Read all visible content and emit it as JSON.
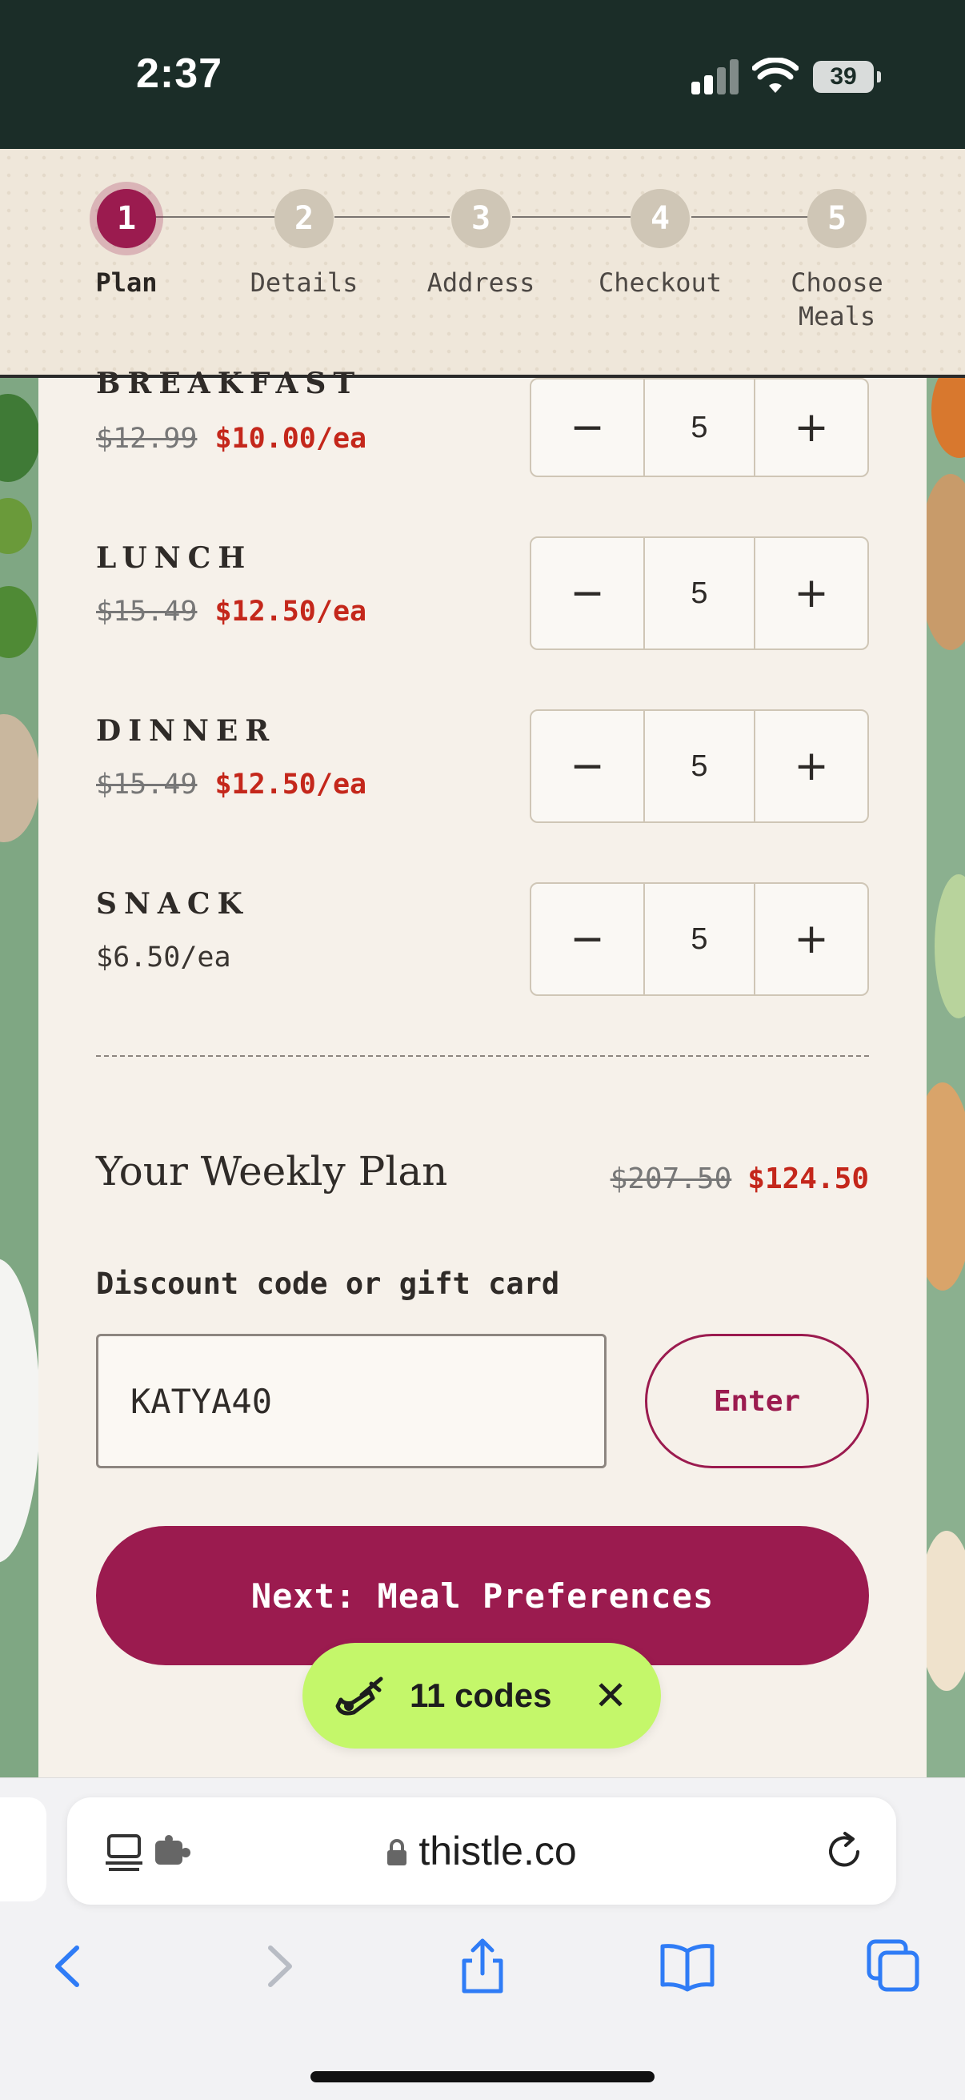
{
  "status_bar": {
    "time": "2:37",
    "battery": "39"
  },
  "stepper": {
    "steps": [
      {
        "number": "1",
        "label": "Plan"
      },
      {
        "number": "2",
        "label": "Details"
      },
      {
        "number": "3",
        "label": "Address"
      },
      {
        "number": "4",
        "label": "Checkout"
      },
      {
        "number": "5",
        "label_line1": "Choose",
        "label_line2": "Meals"
      }
    ]
  },
  "meals": [
    {
      "name": "BREAKFAST",
      "old_price": "$12.99",
      "new_price": "$10.00/ea",
      "qty": "5"
    },
    {
      "name": "LUNCH",
      "old_price": "$15.49",
      "new_price": "$12.50/ea",
      "qty": "5"
    },
    {
      "name": "DINNER",
      "old_price": "$15.49",
      "new_price": "$12.50/ea",
      "qty": "5"
    },
    {
      "name": "SNACK",
      "price": "$6.50/ea",
      "qty": "5"
    }
  ],
  "qty_controls": {
    "minus": "−",
    "plus": "+"
  },
  "weekly_plan": {
    "title": "Your Weekly Plan",
    "old_total": "$207.50",
    "new_total": "$124.50"
  },
  "discount": {
    "label": "Discount code or gift card",
    "value": "KATYA40",
    "enter_label": "Enter"
  },
  "next_button": "Next: Meal Preferences",
  "codes_toast": {
    "text": "11 codes",
    "close": "✕"
  },
  "browser": {
    "url": "thistle.co"
  },
  "colors": {
    "brand": "#9b1b4f",
    "sale_red": "#c4271b",
    "toast": "#c4f76a",
    "ios_blue": "#2f7cf6"
  }
}
